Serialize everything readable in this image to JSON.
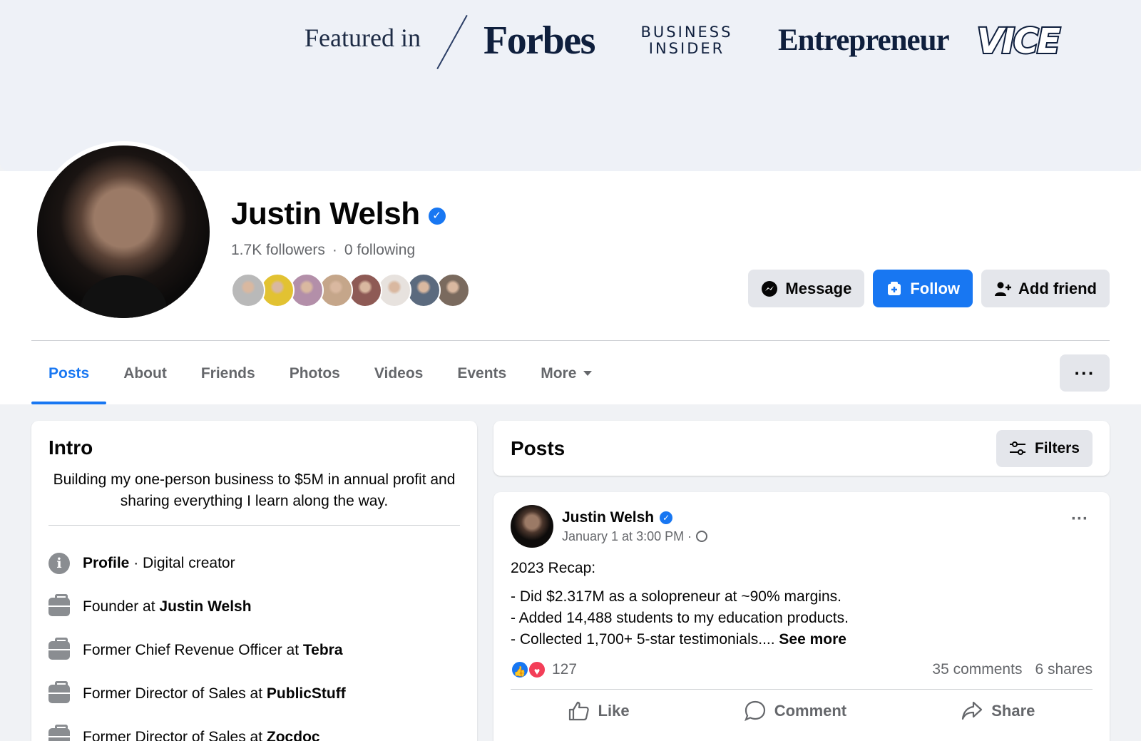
{
  "cover": {
    "featured_label": "Featured in",
    "logos": {
      "forbes": "Forbes",
      "business_insider_line1": "BUSINESS",
      "business_insider_line2": "INSIDER",
      "entrepreneur": "Entrepreneur",
      "vice": "VICE"
    }
  },
  "profile": {
    "name": "Justin Welsh",
    "verified": true,
    "followers": "1.7K followers",
    "following": "0 following",
    "separator": "·",
    "friend_avatar_colors": [
      "#b9b9b9",
      "#e2c232",
      "#b38fa9",
      "#c5a68a",
      "#8e5a55",
      "#e7e2de",
      "#5b6a7e",
      "#7a6a5e"
    ]
  },
  "actions": {
    "message": "Message",
    "follow": "Follow",
    "add_friend": "Add friend"
  },
  "tabs": [
    {
      "label": "Posts",
      "active": true
    },
    {
      "label": "About"
    },
    {
      "label": "Friends"
    },
    {
      "label": "Photos"
    },
    {
      "label": "Videos"
    },
    {
      "label": "Events"
    },
    {
      "label": "More"
    }
  ],
  "more_dots": "···",
  "intro": {
    "title": "Intro",
    "bio": "Building my one-person business to $5M in annual profit and sharing everything I learn along the way.",
    "items": [
      {
        "icon": "info-icon",
        "bold": "Profile",
        "text": " · Digital creator",
        "bold_first": true
      },
      {
        "icon": "briefcase-icon",
        "text": "Founder at ",
        "bold": "Justin Welsh"
      },
      {
        "icon": "briefcase-icon",
        "text": "Former Chief Revenue Officer at ",
        "bold": "Tebra"
      },
      {
        "icon": "briefcase-icon",
        "text": "Former Director of Sales at ",
        "bold": "PublicStuff"
      },
      {
        "icon": "briefcase-icon",
        "text": "Former Director of Sales at ",
        "bold": "Zocdoc"
      }
    ]
  },
  "posts_header": {
    "title": "Posts",
    "filters": "Filters"
  },
  "post": {
    "author": "Justin Welsh",
    "timestamp": "January 1 at 3:00 PM ·",
    "title_line": "2023 Recap:",
    "lines": [
      "- Did $2.317M as a solopreneur at ~90% margins.",
      "- Added 14,488 students to my education products.",
      "- Collected 1,700+ 5-star testimonials.... "
    ],
    "see_more": "See more",
    "reaction_count": "127",
    "comments": "35 comments",
    "shares": "6 shares",
    "actions": {
      "like": "Like",
      "comment": "Comment",
      "share": "Share"
    },
    "menu": "···"
  },
  "colors": {
    "brand_blue": "#1877f2",
    "secondary_text": "#65676b",
    "button_gray": "#e4e6eb",
    "love_red": "#f33e58"
  }
}
